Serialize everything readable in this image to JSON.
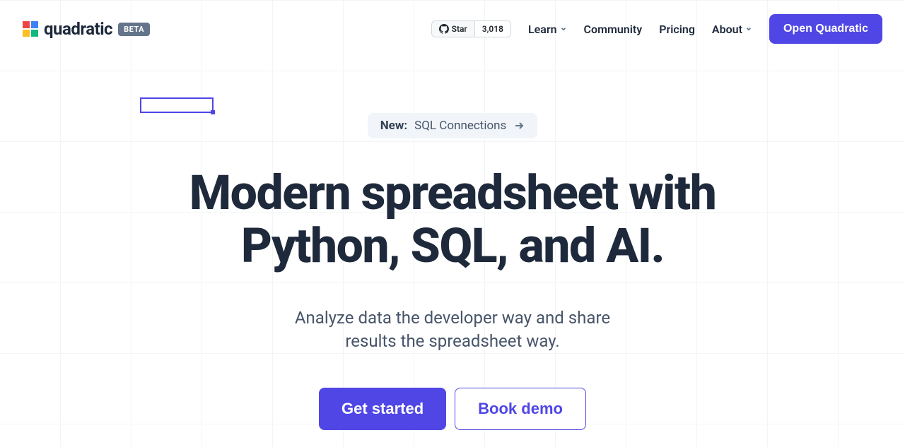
{
  "brand": {
    "name": "quadratic",
    "badge": "BETA"
  },
  "github": {
    "star_label": "Star",
    "star_count": "3,018"
  },
  "nav": {
    "learn": "Learn",
    "community": "Community",
    "pricing": "Pricing",
    "about": "About",
    "open_button": "Open Quadratic"
  },
  "announcement": {
    "new_label": "New:",
    "text": "SQL Connections"
  },
  "hero": {
    "title": "Modern spreadsheet with Python, SQL, and AI.",
    "subtitle": "Analyze data the developer way and share results the spreadsheet way."
  },
  "cta": {
    "primary": "Get started",
    "secondary": "Book demo"
  }
}
